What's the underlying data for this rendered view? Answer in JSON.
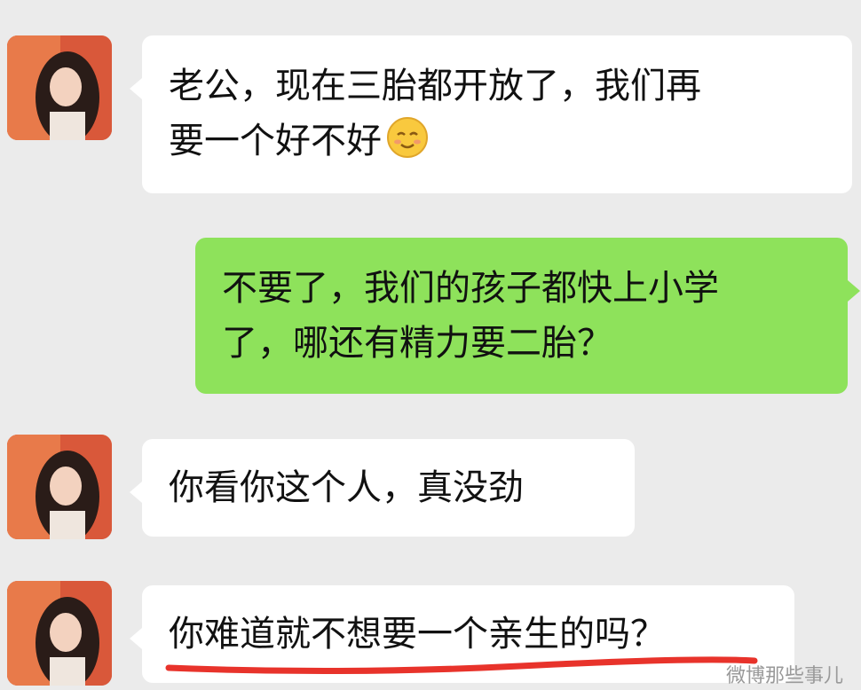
{
  "conversation": {
    "messages": [
      {
        "side": "left",
        "line1": "老公，现在三胎都开放了，我们再",
        "line2": "要一个好不好",
        "emoji": "smiling-face-emoji"
      },
      {
        "side": "right",
        "line1": "不要了，我们的孩子都快上小学",
        "line2": "了，哪还有精力要二胎？"
      },
      {
        "side": "left",
        "line1": "你看你这个人，真没劲"
      },
      {
        "side": "left",
        "line1": "你难道就不想要一个亲生的吗？"
      }
    ]
  },
  "watermark": "微博那些事儿",
  "colors": {
    "background": "#ebebeb",
    "left_bubble": "#ffffff",
    "right_bubble": "#8ee25b",
    "underline": "#e8332b"
  },
  "icons": {
    "avatar": "woman-portrait-avatar",
    "emoji": "smiling-face-emoji"
  }
}
